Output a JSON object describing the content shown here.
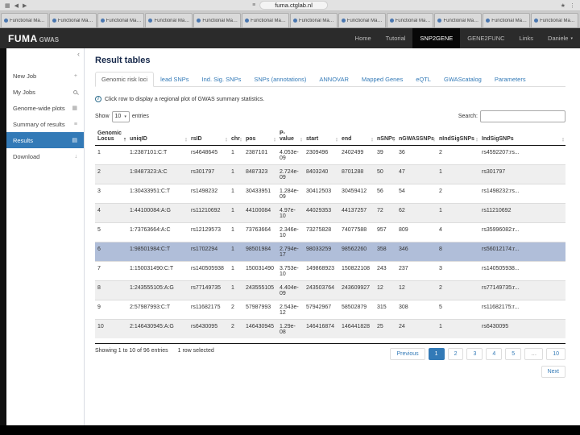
{
  "browser": {
    "url": "fuma.ctglab.nl",
    "menu_icon": "hamburger",
    "tab_title": "Functional Mappin...",
    "tab_count": 12
  },
  "navbar": {
    "brand_fuma": "FUMA",
    "brand_gwas": "GWAS",
    "items": [
      {
        "label": "Home",
        "active": false,
        "caret": false
      },
      {
        "label": "Tutorial",
        "active": false,
        "caret": false
      },
      {
        "label": "SNP2GENE",
        "active": true,
        "caret": false
      },
      {
        "label": "GENE2FUNC",
        "active": false,
        "caret": false
      },
      {
        "label": "Links",
        "active": false,
        "caret": false
      },
      {
        "label": "Daniele",
        "active": false,
        "caret": true
      }
    ]
  },
  "sidebar": {
    "items": [
      {
        "label": "New Job",
        "icon": "user-plus-icon",
        "active": false
      },
      {
        "label": "My Jobs",
        "icon": "search-icon",
        "active": false
      },
      {
        "label": "Genome-wide plots",
        "icon": "chart-icon",
        "active": false
      },
      {
        "label": "Summary of results",
        "icon": "list-icon",
        "active": false
      },
      {
        "label": "Results",
        "icon": "table-icon",
        "active": true
      },
      {
        "label": "Download",
        "icon": "download-icon",
        "active": false
      }
    ]
  },
  "main": {
    "title": "Result tables",
    "tabs": [
      "Genomic risk loci",
      "lead SNPs",
      "Ind. Sig. SNPs",
      "SNPs (annotations)",
      "ANNOVAR",
      "Mapped Genes",
      "eQTL",
      "GWAScatalog",
      "Parameters"
    ],
    "active_tab": "Genomic risk loci",
    "info": "Click row to display a regional plot of GWAS summary statistics.",
    "show_label": "Show",
    "page_length": "10",
    "entries_label": "entries",
    "search_label": "Search:",
    "search_value": "",
    "accent_color": "#337ab7",
    "selected_row_color": "#b0bed9",
    "table": {
      "headers": [
        "Genomic Locus",
        "uniqID",
        "rsID",
        "chr",
        "pos",
        "P-value",
        "start",
        "end",
        "nSNPs",
        "nGWASSNPs",
        "nIndSigSNPs",
        "IndSigSNPs"
      ],
      "sorted_column": "Genomic Locus",
      "selected_index": 5,
      "rows": [
        [
          "1",
          "1:2387101:C:T",
          "rs4648645",
          "1",
          "2387101",
          "4.053e-09",
          "2309496",
          "2402499",
          "39",
          "36",
          "2",
          "rs4592207:rs..."
        ],
        [
          "2",
          "1:8487323:A:C",
          "rs301797",
          "1",
          "8487323",
          "2.724e-09",
          "8403240",
          "8701288",
          "50",
          "47",
          "1",
          "rs301797"
        ],
        [
          "3",
          "1:30433951:C:T",
          "rs1498232",
          "1",
          "30433951",
          "1.284e-09",
          "30412503",
          "30459412",
          "56",
          "54",
          "2",
          "rs1498232:rs..."
        ],
        [
          "4",
          "1:44100084:A:G",
          "rs11210692",
          "1",
          "44100084",
          "4.97e-10",
          "44029353",
          "44137257",
          "72",
          "62",
          "1",
          "rs11210692"
        ],
        [
          "5",
          "1:73763664:A:C",
          "rs12129573",
          "1",
          "73763664",
          "2.346e-10",
          "73275828",
          "74077588",
          "957",
          "809",
          "4",
          "rs35996082:r..."
        ],
        [
          "6",
          "1:98501984:C:T",
          "rs1702294",
          "1",
          "98501984",
          "2.794e-17",
          "98033259",
          "98562260",
          "358",
          "346",
          "8",
          "rs56012174:r..."
        ],
        [
          "7",
          "1:150031490:C:T",
          "rs140505938",
          "1",
          "150031490",
          "3.753e-10",
          "149868923",
          "150822108",
          "243",
          "237",
          "3",
          "rs140505938..."
        ],
        [
          "8",
          "1:243555105:A:G",
          "rs77149735",
          "1",
          "243555105",
          "4.404e-09",
          "243503764",
          "243609927",
          "12",
          "12",
          "2",
          "rs77149735:r..."
        ],
        [
          "9",
          "2:57987993:C:T",
          "rs11682175",
          "2",
          "57987993",
          "2.543e-12",
          "57942967",
          "58502879",
          "315",
          "308",
          "5",
          "rs11682175:r..."
        ],
        [
          "10",
          "2:146430945:A:G",
          "rs6430095",
          "2",
          "146430945",
          "1.29e-08",
          "146416874",
          "146441828",
          "25",
          "24",
          "1",
          "rs6430095"
        ]
      ]
    },
    "footer": {
      "showing": "Showing 1 to 10 of 96 entries",
      "selected": "1 row selected"
    },
    "pagination": {
      "previous": "Previous",
      "pages": [
        "1",
        "2",
        "3",
        "4",
        "5",
        "…",
        "10"
      ],
      "active": "1",
      "next": "Next"
    }
  }
}
